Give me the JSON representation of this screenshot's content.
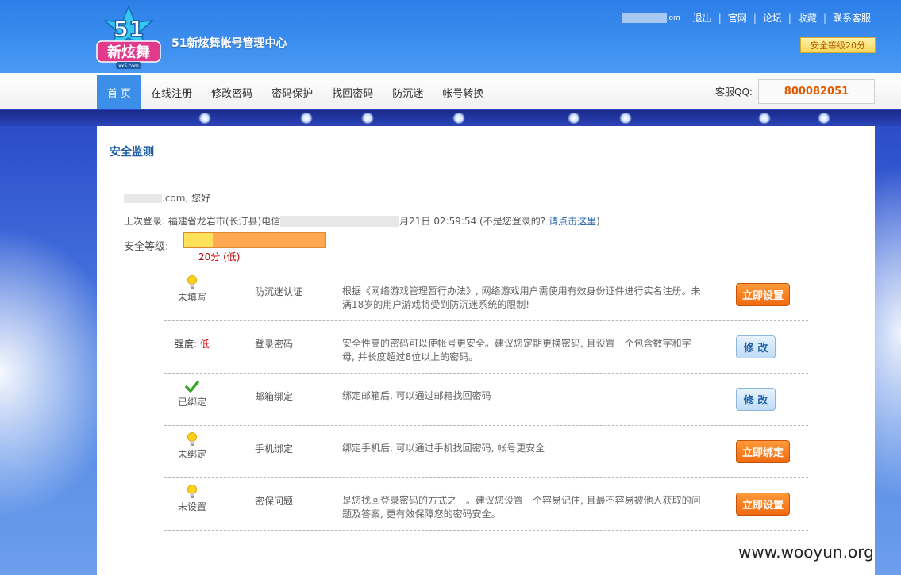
{
  "header": {
    "site_title": "51新炫舞帐号管理中心",
    "user_suffix": "om",
    "links": [
      "退出",
      "官网",
      "论坛",
      "收藏",
      "联系客服"
    ],
    "security_badge": "安全等级20分"
  },
  "logo": {
    "number": "51",
    "name": "新炫舞",
    "domain": "xx5.com"
  },
  "nav": {
    "items": [
      "首 页",
      "在线注册",
      "修改密码",
      "密码保护",
      "找回密码",
      "防沉迷",
      "帐号转换"
    ],
    "active_index": 0,
    "qq_label": "客服QQ:",
    "qq_number": "800082051"
  },
  "panel": {
    "title": "安全监测",
    "greeting_suffix": ".com, 您好",
    "last_login_prefix": "上次登录: 福建省龙岩市(长汀县)电信",
    "last_login_suffix": "月21日 02:59:54  (不是您登录的?",
    "last_login_link": "请点击这里",
    "last_login_close": ")",
    "security_level_label": "安全等级:",
    "security_level_fraction": 0.2,
    "security_score_text": "20分 (低)"
  },
  "rows": [
    {
      "status": "未填写",
      "icon": "bulb-icon",
      "name": "防沉迷认证",
      "desc": "根据《网络游戏管理暂行办法》, 网络游戏用户需使用有效身份证件进行实名注册。未满18岁的用户游戏将受到防沉迷系统的限制!",
      "button": "立即设置",
      "button_style": "orange"
    },
    {
      "status_label": "强度:",
      "status_value": "低",
      "name": "登录密码",
      "desc": "安全性高的密码可以使帐号更安全。建议您定期更换密码, 且设置一个包含数字和字母, 并长度超过8位以上的密码。",
      "button": "修 改",
      "button_style": "blue"
    },
    {
      "status": "已绑定",
      "icon": "check-icon",
      "name": "邮箱绑定",
      "desc": "绑定邮箱后, 可以通过邮箱找回密码",
      "button": "修 改",
      "button_style": "blue"
    },
    {
      "status": "未绑定",
      "icon": "bulb-icon",
      "name": "手机绑定",
      "desc": "绑定手机后, 可以通过手机找回密码, 帐号更安全",
      "button": "立即绑定",
      "button_style": "orange"
    },
    {
      "status": "未设置",
      "icon": "bulb-icon",
      "name": "密保问题",
      "desc": "是您找回登录密码的方式之一。建议您设置一个容易记住, 且最不容易被他人获取的问题及答案, 更有效保障您的密码安全。",
      "button": "立即设置",
      "button_style": "orange"
    }
  ],
  "watermark": "www.wooyun.org",
  "colors": {
    "header_blue": "#3d8ef0",
    "accent_link": "#1e5fa8",
    "orange_button": "#f06a10",
    "qq_number": "#e05a00"
  }
}
